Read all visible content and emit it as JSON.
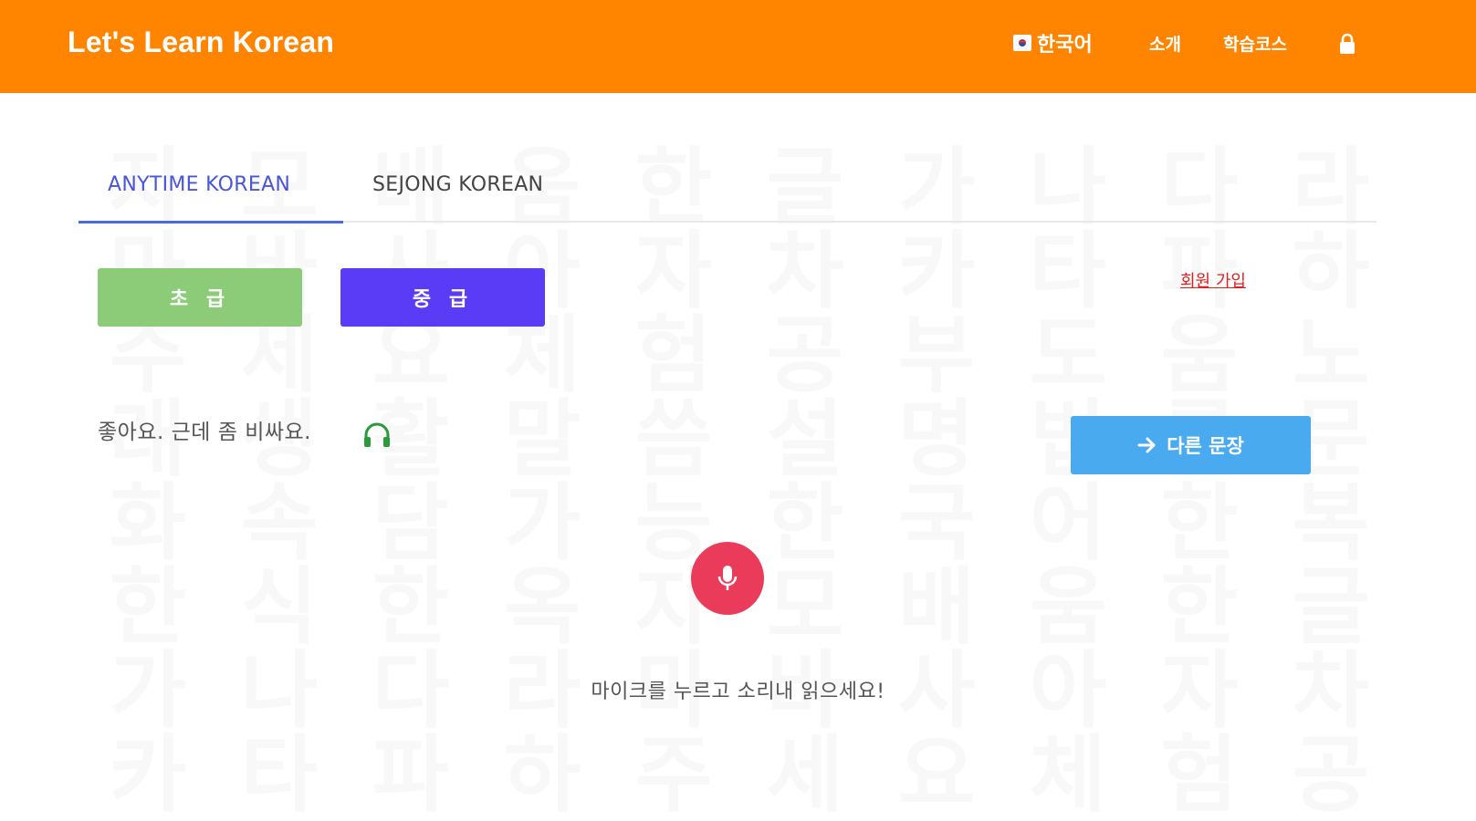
{
  "header": {
    "brand": "Let's Learn Korean",
    "nav": {
      "language": "한국어",
      "about": "소개",
      "courses": "학습코스"
    },
    "icons": [
      "flag-icon",
      "lock-icon"
    ]
  },
  "tabs": [
    {
      "label": "ANYTIME KOREAN",
      "active": true
    },
    {
      "label": "SEJONG KOREAN",
      "active": false
    }
  ],
  "levels": {
    "beginner": "초 급",
    "intermediate": "중 급"
  },
  "signup": "회원 가입",
  "practice": {
    "sentence": "좋아요. 근데 좀 비싸요.",
    "next_label": "다른 문장",
    "mic_hint": "마이크를 누르고 소리내 읽으세요!"
  },
  "watermark": "자모배움한글 가나다라마바사아자차카타파하 주세요 체험 공부 도움 노래 생활 말씀 설명 법률 문화 속담 가능 한국어 한복 한식 한옥",
  "colors": {
    "header": "#ff8400",
    "tab_active": "#4a56d8",
    "beginner": "#8ccc78",
    "intermediate": "#5b3cf6",
    "next": "#4aaaf0",
    "mic": "#ea3c5a",
    "signup": "#e0201e",
    "headphones": "#2a9a3a"
  }
}
